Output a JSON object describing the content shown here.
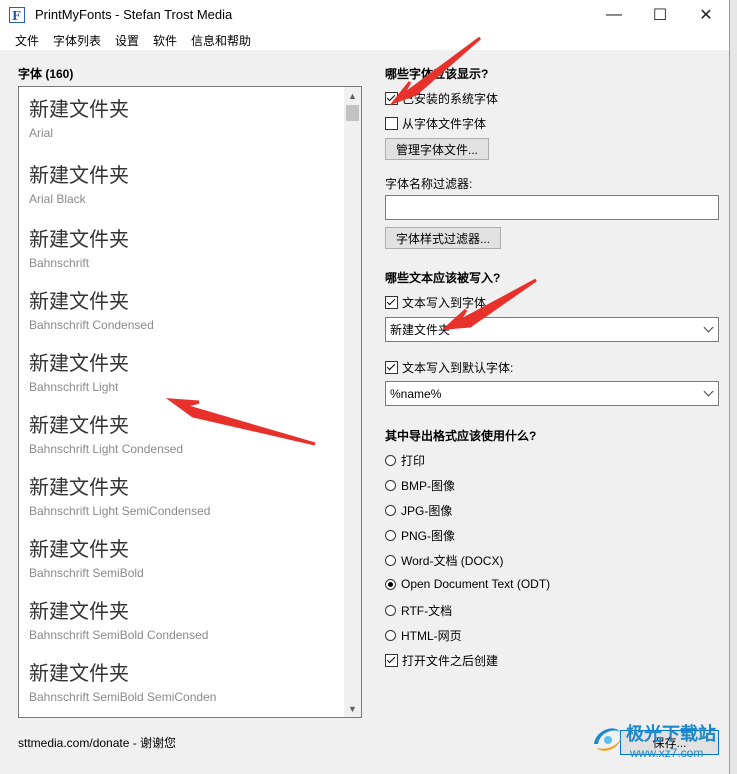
{
  "window": {
    "title": "PrintMyFonts - Stefan Trost Media"
  },
  "titlebar": {
    "minimize": "—",
    "maximize": "☐",
    "close": "✕"
  },
  "menu": [
    "文件",
    "字体列表",
    "设置",
    "软件",
    "信息和帮助"
  ],
  "font_list": {
    "title": "字体 (160)",
    "sample_text": "新建文件夹",
    "items": [
      "Arial",
      "Arial Black",
      "Bahnschrift",
      "Bahnschrift Condensed",
      "Bahnschrift Light",
      "Bahnschrift Light Condensed",
      "Bahnschrift Light SemiCondensed",
      "Bahnschrift SemiBold",
      "Bahnschrift SemiBold Condensed",
      "Bahnschrift SemiBold SemiConden"
    ],
    "scroll_up": "▲",
    "scroll_down": "▼"
  },
  "which_fonts": {
    "title": "哪些字体应该显示?",
    "installed_label": "已安装的系统字体",
    "installed_checked": true,
    "from_files_label": "从字体文件字体",
    "from_files_checked": false,
    "manage_button": "管理字体文件..."
  },
  "filter": {
    "label": "字体名称过滤器:",
    "value": "",
    "style_filter_button": "字体样式过滤器..."
  },
  "which_text": {
    "title": "哪些文本应该被写入?",
    "write_to_font_label": "文本写入到字体",
    "write_to_font_checked": true,
    "text_value": "新建文件夹",
    "write_default_label": "文本写入到默认字体:",
    "write_default_checked": true,
    "default_value": "%name%"
  },
  "export": {
    "title": "其中导出格式应该使用什么?",
    "options": [
      "打印",
      "BMP-图像",
      "JPG-图像",
      "PNG-图像",
      "Word-文档 (DOCX)",
      "Open Document Text (ODT)",
      "RTF-文档",
      "HTML-网页"
    ],
    "selected_index": 5,
    "open_after_label": "打开文件之后创建",
    "open_after_checked": true
  },
  "footer": {
    "donate_text": "sttmedia.com/donate - 谢谢您",
    "save_button": "保存..."
  },
  "watermark": {
    "text": "极光下载站",
    "url": "www.xz7.com"
  },
  "colors": {
    "arrow": "#e8312a",
    "accent": "#0078d7",
    "watermark": "#1e88c8"
  }
}
